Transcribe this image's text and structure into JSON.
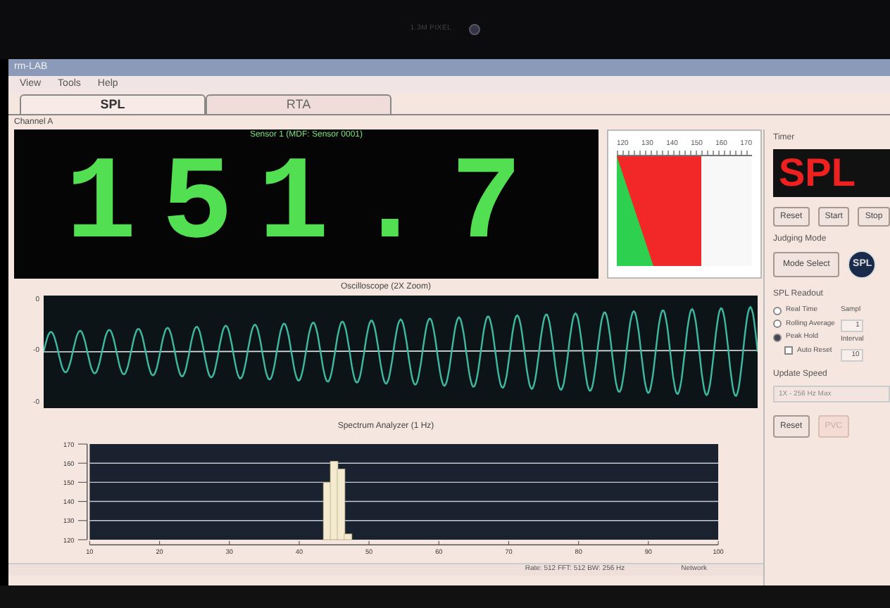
{
  "bezel": {
    "label": "1.3M PIXEL"
  },
  "window": {
    "title": "rm-LAB"
  },
  "menu": [
    "View",
    "Tools",
    "Help"
  ],
  "tabs": [
    {
      "label": "SPL",
      "selected": true
    },
    {
      "label": "RTA",
      "selected": false
    }
  ],
  "channel_label": "Channel A",
  "display": {
    "sensor": "Sensor 1 (MDF: Sensor 0001)",
    "reading": "151.7"
  },
  "meter": {
    "scale": [
      "120",
      "130",
      "140",
      "150",
      "160",
      "170"
    ],
    "level": 0.62
  },
  "timer": {
    "label": "Timer",
    "display": "SPL",
    "buttons": [
      "Reset",
      "Start",
      "Stop"
    ]
  },
  "judging_mode": {
    "label": "Judging Mode",
    "button": "Mode Select",
    "logo": "SPL"
  },
  "readout": {
    "label": "SPL Readout",
    "options": [
      {
        "label": "Real Time",
        "selected": false
      },
      {
        "label": "Rolling Average",
        "selected": false
      },
      {
        "label": "Peak Hold",
        "selected": true
      }
    ],
    "auto_reset": {
      "label": "Auto Reset",
      "checked": false
    },
    "sample_label": "Sampl",
    "sample_value": "1",
    "interval_label": "Interval",
    "interval_value": "10"
  },
  "update_speed": {
    "label": "Update Speed",
    "value": "1X - 256 Hz Max"
  },
  "actions": [
    {
      "label": "Reset",
      "disabled": false
    },
    {
      "label": "PVC",
      "disabled": true
    }
  ],
  "oscilloscope": {
    "title": "Oscilloscope (2X Zoom)",
    "y_labels": [
      "0",
      "-0",
      "-0"
    ]
  },
  "spectrum": {
    "chart_data": {
      "type": "bar",
      "title": "Spectrum Analyzer (1 Hz)",
      "grid": true,
      "x": [
        44,
        45,
        46,
        47
      ],
      "series": [
        {
          "color": "#f3ead0",
          "values": [
            150,
            161,
            157,
            123
          ]
        }
      ],
      "xlim": [
        10,
        100
      ],
      "ylim": [
        120,
        170
      ],
      "xticks": [
        10,
        20,
        30,
        40,
        50,
        60,
        70,
        80,
        90,
        100
      ],
      "yticks": [
        120,
        130,
        140,
        150,
        160,
        170
      ]
    }
  },
  "status_bar": {
    "info": "Rate: 512 FFT: 512 BW: 256 Hz",
    "network": "Network"
  }
}
